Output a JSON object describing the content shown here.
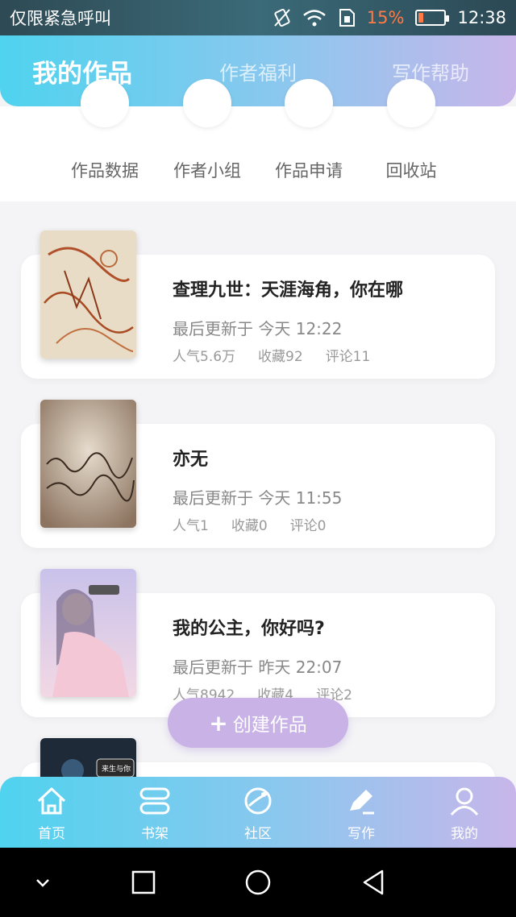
{
  "status_bar": {
    "carrier": "仅限紧急呼叫",
    "battery": "15%",
    "battery_level": 0.15,
    "time": "12:38"
  },
  "header": {
    "tabs": [
      {
        "label": "我的作品",
        "active": true
      },
      {
        "label": "作者福利",
        "active": false
      },
      {
        "label": "写作帮助",
        "active": false
      }
    ]
  },
  "quick_menu": {
    "items": [
      {
        "label": "作品数据"
      },
      {
        "label": "作者小组"
      },
      {
        "label": "作品申请"
      },
      {
        "label": "回收站"
      }
    ]
  },
  "works": [
    {
      "title": "查理九世：天涯海角，你在哪",
      "updated": "最后更新于 今天 12:22",
      "popularity": "人气5.6万",
      "favorites": "收藏92",
      "comments": "评论11"
    },
    {
      "title": "亦无",
      "updated": "最后更新于 今天 11:55",
      "popularity": "人气1",
      "favorites": "收藏0",
      "comments": "评论0"
    },
    {
      "title": "我的公主，你好吗?",
      "updated": "最后更新于 昨天 22:07",
      "popularity": "人气8942",
      "favorites": "收藏4",
      "comments": "评论2"
    },
    {
      "title": "",
      "cover_text": "来生与你"
    }
  ],
  "fab": {
    "label": "创建作品"
  },
  "bottom_nav": {
    "items": [
      {
        "label": "首页",
        "icon": "home-icon"
      },
      {
        "label": "书架",
        "icon": "bookshelf-icon"
      },
      {
        "label": "社区",
        "icon": "planet-icon"
      },
      {
        "label": "写作",
        "icon": "pen-icon"
      },
      {
        "label": "我的",
        "icon": "user-icon"
      }
    ]
  },
  "colors": {
    "accent_blue": "#4fd3ee",
    "accent_purple": "#c8b2e6",
    "battery_warning": "#ff7a45"
  }
}
